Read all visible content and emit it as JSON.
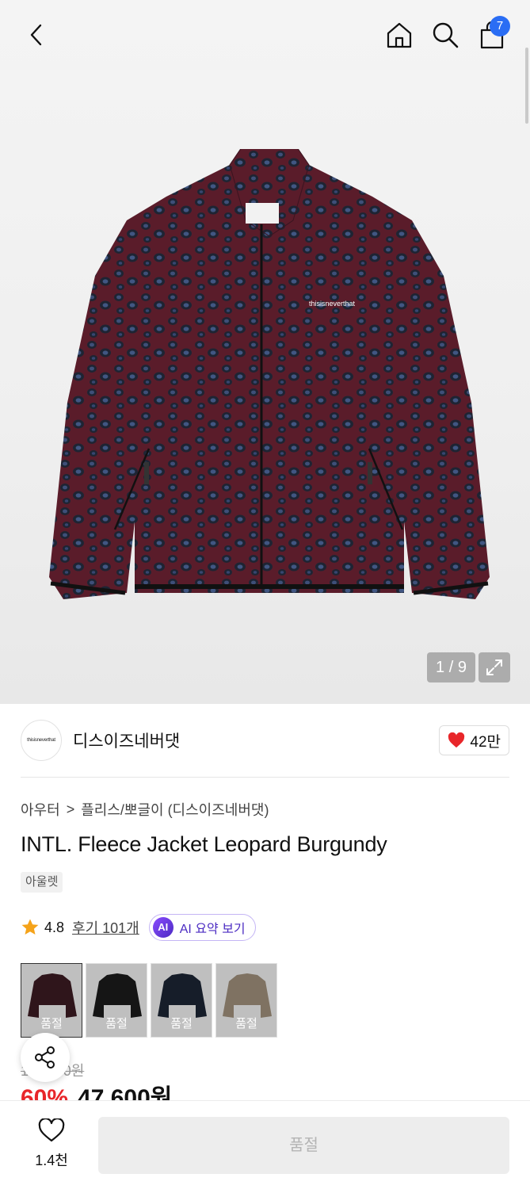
{
  "header": {
    "cart_count": "7"
  },
  "gallery": {
    "pager": "1 / 9",
    "jacket_logo": "thisisneverthat"
  },
  "brand": {
    "logo_text": "thisisneverthat",
    "name": "디스이즈네버댓",
    "likes": "42만"
  },
  "breadcrumb": {
    "level1": "아우터",
    "separator": ">",
    "level2": "플리스/뽀글이 (디스이즈네버댓)"
  },
  "product": {
    "title": "INTL. Fleece Jacket Leopard Burgundy",
    "tag": "아울렛",
    "rating": "4.8",
    "review_link": "후기 101개",
    "ai_badge": "AI",
    "ai_label": "AI 요약 보기"
  },
  "colors": {
    "options": [
      {
        "color": "#3a1a22",
        "label": "품절"
      },
      {
        "color": "#1a1a1a",
        "label": "품절"
      },
      {
        "color": "#1c2433",
        "label": "품절"
      },
      {
        "color": "#9b8c78",
        "label": "품절"
      }
    ]
  },
  "price": {
    "original": "119,000원",
    "discount": "60%",
    "sale": "47,600원"
  },
  "bottom": {
    "wish_count": "1.4천",
    "buy_label": "품절"
  },
  "theme": {
    "accent": "#2a6df4",
    "sale_red": "#e8262a",
    "heart_red": "#e8262a",
    "ai_purple": "#4b2bc2"
  }
}
